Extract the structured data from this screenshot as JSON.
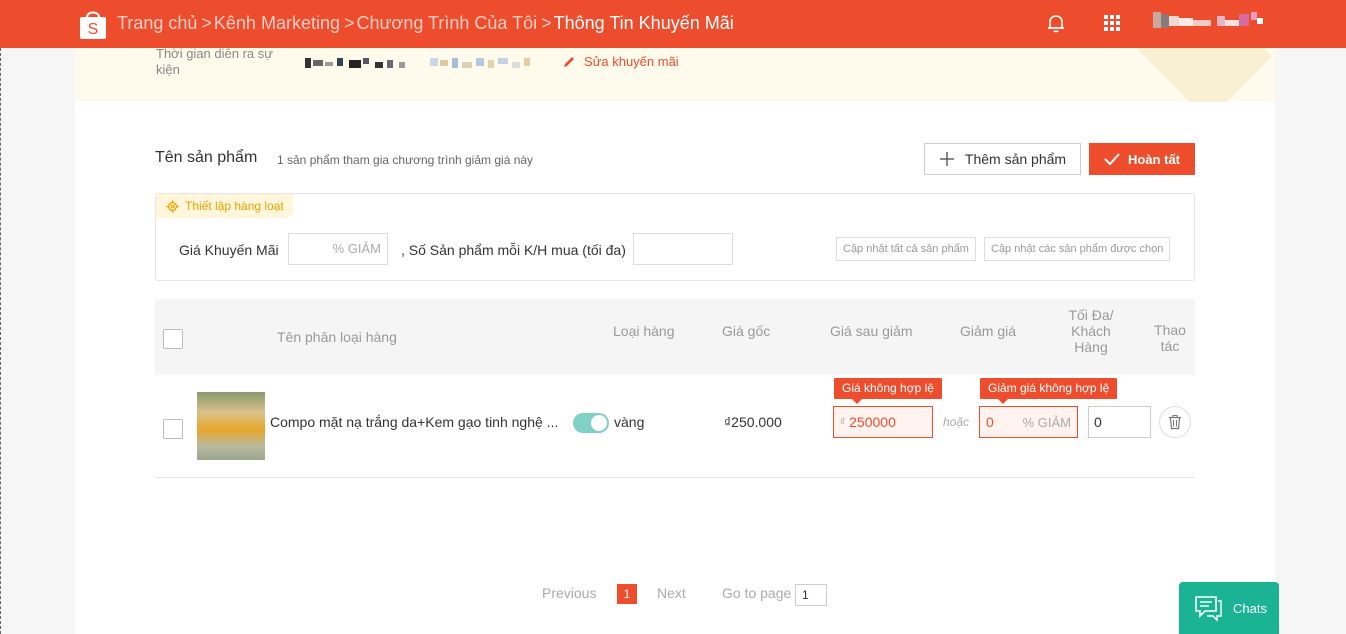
{
  "header": {
    "logo_letter": "S",
    "breadcrumb": [
      {
        "label": "Trang chủ"
      },
      {
        "label": "Kênh Marketing"
      },
      {
        "label": "Chương Trình Của Tôi"
      },
      {
        "label": "Thông Tin Khuyến Mãi"
      }
    ],
    "separator": ">"
  },
  "event": {
    "time_label": "Thời gian diễn ra sự kiện",
    "edit_label": "Sửa khuyến mãi"
  },
  "products": {
    "title": "Tên sản phẩm",
    "subtitle": "1 sản phẩm tham gia chương trình giảm giá này",
    "add_button": "Thêm sản phẩm",
    "done_button": "Hoàn tất"
  },
  "bulk": {
    "tag": "Thiết lập hàng loạt",
    "promo_price_label": "Giá Khuyến Mãi",
    "promo_price_placeholder": "% GIẢM",
    "max_per_customer_label": ", Số Sản phẩm mỗi K/H mua (tối đa)",
    "update_all": "Cập nhật tất cả sản phẩm",
    "update_selected": "Cập nhật các sản phẩm được chọn"
  },
  "table": {
    "columns": {
      "variant_name": "Tên phân loại hàng",
      "type": "Loại hàng",
      "original_price": "Giá gốc",
      "sale_price": "Giá sau giảm",
      "discount": "Giảm giá",
      "max_per_customer": "Tối Đa/ Khách Hàng",
      "actions": "Thao tác"
    },
    "rows": [
      {
        "name": "Compo mặt nạ trắng da+Kem gạo tinh nghệ ...",
        "variant": "vàng",
        "original_price": "₫250.000",
        "price_error": "Giá không hợp lệ",
        "currency": "₫",
        "sale_price": "250000",
        "or_label": "hoặc",
        "discount_error": "Giảm giá không hợp lệ",
        "discount_value": "0",
        "discount_unit": "% GIẢM",
        "max_value": "0"
      }
    ]
  },
  "pagination": {
    "previous": "Previous",
    "current": "1",
    "next": "Next",
    "goto_label": "Go to page",
    "goto_value": "1"
  },
  "chat": {
    "label": "Chats"
  },
  "colors": {
    "brand": "#ee4d2d",
    "chat": "#1ab394"
  }
}
